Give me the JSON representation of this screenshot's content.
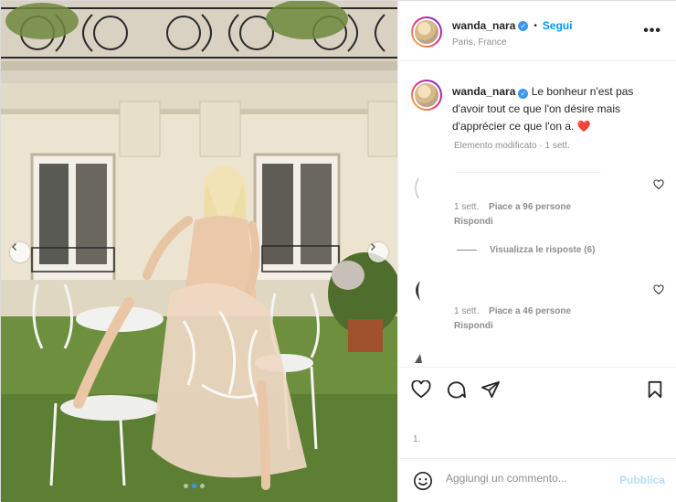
{
  "post": {
    "username": "wanda_nara",
    "follow_label": "Segui",
    "dot": "•",
    "location": "Paris, France",
    "more_label": "•••"
  },
  "caption": {
    "username": "wanda_nara",
    "text": "Le bonheur n'est pas d'avoir tout ce que l'on désire mais d'apprécier ce que l'on a.",
    "emoji": "❤️",
    "meta": "Elemento modificato · 1 sett."
  },
  "comments": [
    {
      "time": "1 sett.",
      "likes": "Piace a 96 persone",
      "reply": "Rispondi"
    },
    {
      "time": "1 sett.",
      "likes": "Piace a 46 persone",
      "reply": "Rispondi"
    }
  ],
  "view_replies": "Visualizza le risposte (6)",
  "likes_line": "1.",
  "add_comment": {
    "placeholder": "Aggiungi un commento...",
    "publish": "Pubblica"
  },
  "colors": {
    "accent": "#0095f6",
    "muted": "#8e8e8e",
    "heart": "#ed4956",
    "publish_disabled": "#b2dffc"
  },
  "carousel": {
    "slides": 3,
    "active": 1
  }
}
